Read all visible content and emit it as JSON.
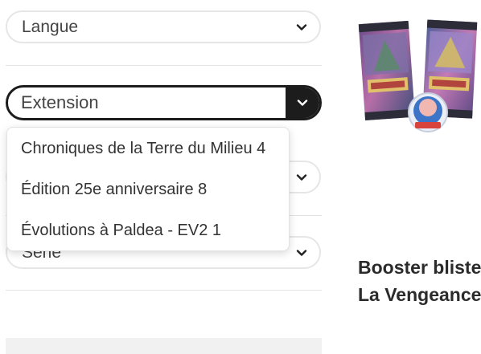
{
  "filters": {
    "langue": {
      "label": "Langue"
    },
    "extension": {
      "label": "Extension",
      "options": [
        "Chroniques de la Terre du Milieu 4",
        "Édition 25e anniversaire 8",
        "Évolutions à Paldea - EV2 1"
      ]
    },
    "serie": {
      "label": "Série"
    }
  },
  "product": {
    "image_icon": "booster-packs-image",
    "title_line1": "Booster bliste",
    "title_line2": "La Vengeance"
  },
  "colors": {
    "active_border": "#1c1c1c",
    "inactive_border": "#e6e6e6",
    "divider": "#e3e3e3"
  }
}
